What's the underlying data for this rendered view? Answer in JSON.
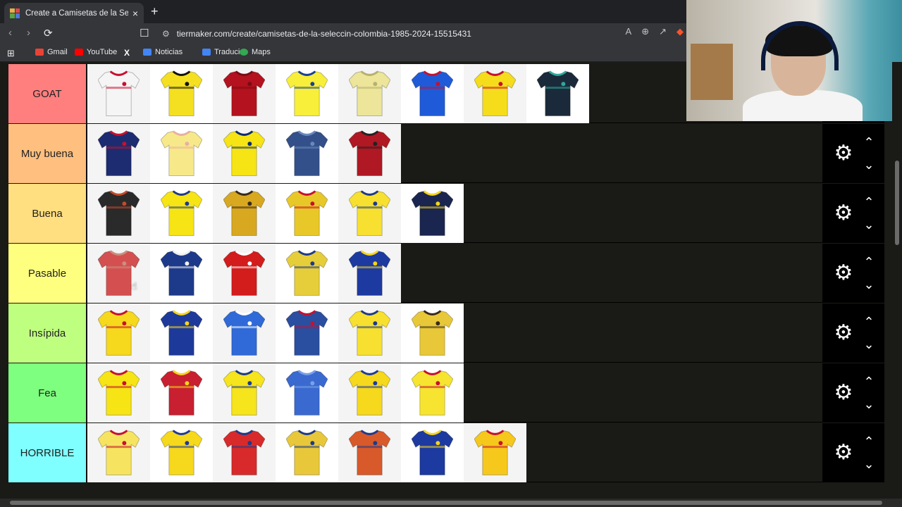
{
  "browser": {
    "tab_title": "Create a Camisetas de la Selecci",
    "url": "tiermaker.com/create/camisetas-de-la-seleccin-colombia-1985-2024-15515431",
    "bookmarks": [
      {
        "label": "Gmail",
        "color": "#ea4335"
      },
      {
        "label": "YouTube",
        "color": "#ff0000"
      },
      {
        "label": "",
        "color": "#000000"
      },
      {
        "label": "Noticias",
        "color": "#4285f4"
      },
      {
        "label": "Traducir",
        "color": "#4285f4"
      },
      {
        "label": "Maps",
        "color": "#34a853"
      }
    ]
  },
  "tiers": [
    {
      "label": "GOAT",
      "color": "#ff7f7f",
      "items": [
        {
          "primary": "#f5f5f5",
          "accent": "#c8102e"
        },
        {
          "primary": "#f4e020",
          "accent": "#111111"
        },
        {
          "primary": "#b3121e",
          "accent": "#7a0b14"
        },
        {
          "primary": "#f7ef3a",
          "accent": "#1c3f94"
        },
        {
          "primary": "#ece59a",
          "accent": "#b8b070"
        },
        {
          "primary": "#1f5bd8",
          "accent": "#c8102e"
        },
        {
          "primary": "#f6dd1c",
          "accent": "#c8102e"
        },
        {
          "primary": "#1a2a3a",
          "accent": "#2fa89c"
        }
      ]
    },
    {
      "label": "Muy buena",
      "color": "#ffbf7f",
      "items": [
        {
          "primary": "#1d2c70",
          "accent": "#c8102e"
        },
        {
          "primary": "#f7e98a",
          "accent": "#e8b0a0"
        },
        {
          "primary": "#f6e414",
          "accent": "#0e2d6e"
        },
        {
          "primary": "#34508a",
          "accent": "#6a88c0"
        },
        {
          "primary": "#b01823",
          "accent": "#222222"
        }
      ]
    },
    {
      "label": "Buena",
      "color": "#ffdf7f",
      "items": [
        {
          "primary": "#2a2a2a",
          "accent": "#c44a2a"
        },
        {
          "primary": "#f6e414",
          "accent": "#1d3a8a"
        },
        {
          "primary": "#d8a820",
          "accent": "#3a2a1a"
        },
        {
          "primary": "#e8c828",
          "accent": "#c8102e"
        },
        {
          "primary": "#f7e030",
          "accent": "#1d3a8a"
        },
        {
          "primary": "#1a2650",
          "accent": "#f4d41c"
        }
      ]
    },
    {
      "label": "Pasable",
      "color": "#ffff7f",
      "items": [
        {
          "primary": "#d45050",
          "accent": "#c89080"
        },
        {
          "primary": "#1d3a8a",
          "accent": "#f0f0f0"
        },
        {
          "primary": "#d31c1c",
          "accent": "#ffffff"
        },
        {
          "primary": "#e6cd3a",
          "accent": "#1d3a8a"
        },
        {
          "primary": "#1d3aa0",
          "accent": "#f6d41c"
        }
      ]
    },
    {
      "label": "Insípida",
      "color": "#bfff7f",
      "items": [
        {
          "primary": "#f6d81c",
          "accent": "#c8102e"
        },
        {
          "primary": "#1d3a9a",
          "accent": "#f6d41c"
        },
        {
          "primary": "#2f6ad8",
          "accent": "#ffffff"
        },
        {
          "primary": "#2a4ea0",
          "accent": "#c8102e"
        },
        {
          "primary": "#f7e030",
          "accent": "#1d3a8a"
        },
        {
          "primary": "#e8c838",
          "accent": "#3a2a1a"
        }
      ]
    },
    {
      "label": "Fea",
      "color": "#7fff7f",
      "items": [
        {
          "primary": "#f6e414",
          "accent": "#c8102e"
        },
        {
          "primary": "#c82030",
          "accent": "#f6d41c"
        },
        {
          "primary": "#f6e41c",
          "accent": "#1d3a8a"
        },
        {
          "primary": "#3a6ad0",
          "accent": "#7aa0e8"
        },
        {
          "primary": "#f6d81c",
          "accent": "#1d3aa0"
        },
        {
          "primary": "#f6e430",
          "accent": "#c8102e"
        }
      ]
    },
    {
      "label": "HORRIBLE",
      "color": "#7fffff",
      "items": [
        {
          "primary": "#f6e460",
          "accent": "#c8102e"
        },
        {
          "primary": "#f6d81c",
          "accent": "#1d3a9a"
        },
        {
          "primary": "#d82a2a",
          "accent": "#1d3a8a"
        },
        {
          "primary": "#e8c83a",
          "accent": "#1d3a8a"
        },
        {
          "primary": "#d85a2a",
          "accent": "#1d3a8a"
        },
        {
          "primary": "#1d3aa0",
          "accent": "#f6d41c"
        },
        {
          "primary": "#f6c81c",
          "accent": "#c8102e"
        }
      ]
    }
  ]
}
